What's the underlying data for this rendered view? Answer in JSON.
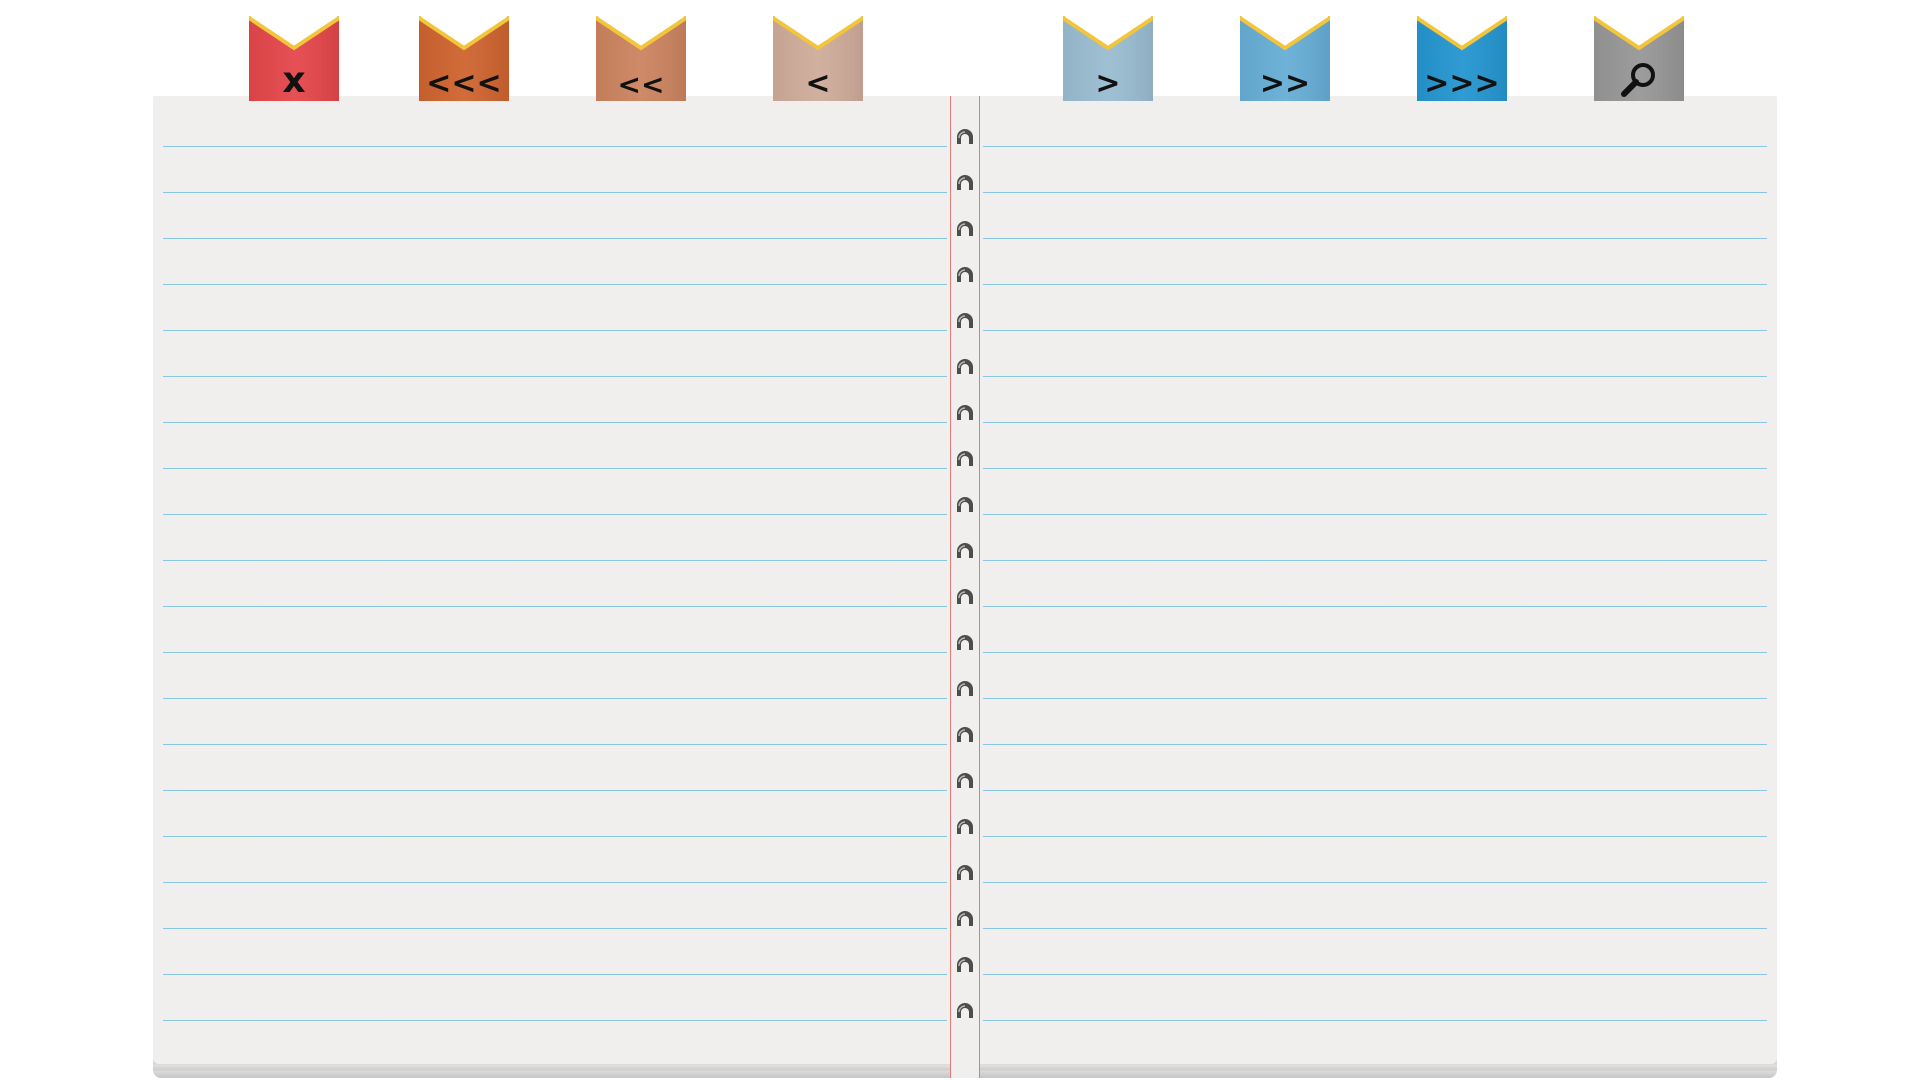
{
  "toolbar": {
    "tabs": [
      {
        "id": "close",
        "label": "x",
        "icon": "close-icon",
        "color": "#e4474b"
      },
      {
        "id": "first",
        "label": "<<<",
        "icon": "triple-chevron-left-icon",
        "color": "#cf6430"
      },
      {
        "id": "back-many",
        "label": "<<",
        "icon": "double-chevron-left-icon",
        "color": "#cc8460"
      },
      {
        "id": "prev",
        "label": "<",
        "icon": "chevron-left-icon",
        "color": "#cfac9b"
      },
      {
        "id": "next",
        "label": ">",
        "icon": "chevron-right-icon",
        "color": "#9abdd1"
      },
      {
        "id": "forward-many",
        "label": ">>",
        "icon": "double-chevron-right-icon",
        "color": "#67aed6"
      },
      {
        "id": "last",
        "label": ">>>",
        "icon": "triple-chevron-right-icon",
        "color": "#2596d0"
      },
      {
        "id": "search",
        "label": "",
        "icon": "magnifier-icon",
        "color": "#979797"
      }
    ],
    "tab_trim_color": "#f3c53a"
  },
  "notebook": {
    "page_color": "#f1eeee",
    "rule_color": "#7cc3e2",
    "margin_line_color": "#e27a7a",
    "left_page_text": "",
    "right_page_text": ""
  }
}
